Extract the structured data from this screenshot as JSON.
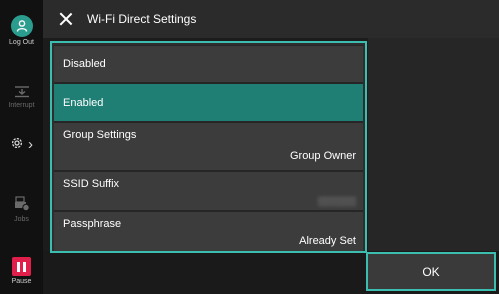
{
  "header": {
    "title": "Wi-Fi Direct Settings"
  },
  "rail": {
    "logout_label": "Log Out",
    "interrupt_label": "Interrupt",
    "jobs_label": "Jobs",
    "pause_label": "Pause"
  },
  "list": {
    "items": [
      {
        "label": "Disabled",
        "value": "",
        "selected": false
      },
      {
        "label": "Enabled",
        "value": "",
        "selected": true
      },
      {
        "label": "Group Settings",
        "value": "Group Owner",
        "selected": false
      },
      {
        "label": "SSID Suffix",
        "value": "",
        "selected": false
      },
      {
        "label": "Passphrase",
        "value": "Already Set",
        "selected": false
      }
    ]
  },
  "footer": {
    "ok_label": "OK"
  },
  "colors": {
    "accent": "#3bbdb0",
    "selected": "#1f7f74",
    "pause": "#e0204a"
  },
  "icons": [
    "logout-icon",
    "interrupt-icon",
    "settings-gear-icon",
    "jobs-icon",
    "pause-icon",
    "close-icon"
  ]
}
